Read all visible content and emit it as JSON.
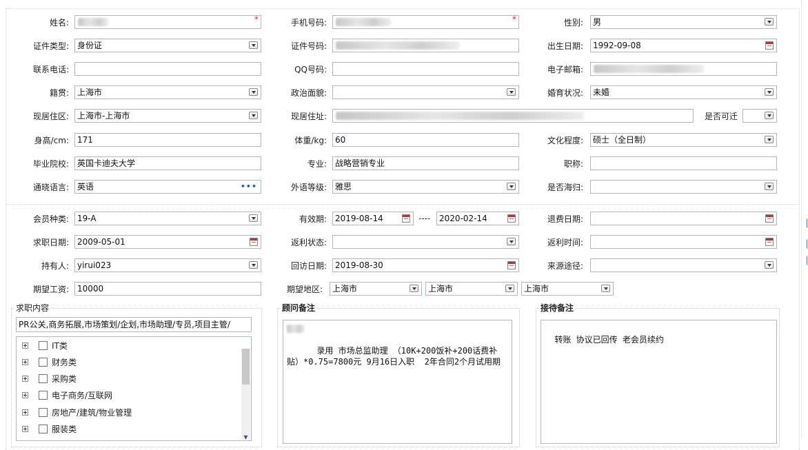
{
  "row1": {
    "name_label": "姓名:",
    "phone_label": "手机号码:",
    "gender_label": "性别:",
    "gender_value": "男"
  },
  "row2": {
    "idtype_label": "证件类型:",
    "idtype_value": "身份证",
    "idnum_label": "证件号码:",
    "birth_label": "出生日期:",
    "birth_value": "1992-09-08"
  },
  "row3": {
    "tel_label": "联系电话:",
    "qq_label": "QQ号码:",
    "email_label": "电子邮箱:"
  },
  "row4": {
    "native_label": "籍贯:",
    "native_value": "上海市",
    "political_label": "政治面貌:",
    "marital_label": "婚育状况:",
    "marital_value": "未婚"
  },
  "row5": {
    "area_label": "现居住区:",
    "area_value": "上海市-上海市",
    "addr_label": "现居住址:",
    "relocate_label": "是否可迁"
  },
  "row6": {
    "height_label": "身高/cm:",
    "height_value": "171",
    "weight_label": "体重/kg:",
    "weight_value": "60",
    "edu_label": "文化程度:",
    "edu_value": "硕士（全日制）"
  },
  "row7": {
    "school_label": "毕业院校:",
    "school_value": "英国卡迪夫大学",
    "major_label": "专业:",
    "major_value": "战略营销专业",
    "title_label": "职称:"
  },
  "row8": {
    "lang_label": "通晓语言:",
    "lang_value": "英语",
    "lang_more": "•••",
    "level_label": "外语等级:",
    "level_value": "雅思",
    "returnee_label": "是否海归:"
  },
  "row9": {
    "member_label": "会员种类:",
    "member_value": "19-A",
    "valid_label": "有效期:",
    "valid_from": "2019-08-14",
    "valid_sep": "----",
    "valid_to": "2020-02-14",
    "refund_label": "退费日期:"
  },
  "row10": {
    "jobdate_label": "求职日期:",
    "jobdate_value": "2009-05-01",
    "rebate_status_label": "返利状态:",
    "rebate_time_label": "返利时间:"
  },
  "row11": {
    "holder_label": "持有人:",
    "holder_value": "yirui023",
    "visit_label": "回访日期:",
    "visit_value": "2019-08-30",
    "source_label": "来源途径:"
  },
  "row12": {
    "salary_label": "期望工资:",
    "salary_value": "10000",
    "region_label": "期望地区:",
    "region1": "上海市",
    "region2": "上海市",
    "region3": "上海市"
  },
  "job": {
    "legend": "求职内容",
    "summary": "PR公关,商务拓展,市场策划/企划,市场助理/专员,项目主管/",
    "tree": [
      "IT类",
      "财务类",
      "采购类",
      "电子商务/互联网",
      "房地产/建筑/物业管理",
      "服装类"
    ]
  },
  "advisor": {
    "legend": "顾问备注",
    "text": "    录用 市场总监助理 （10K+200饭补+200话费补贴）*0.75=7800元 9月16日入职  2年合同2个月试用期"
  },
  "reception": {
    "legend": "接待备注",
    "text": "转账 协议已回传 老会员续约"
  },
  "colors": {
    "border": "#a9b7c6",
    "required": "#e02020",
    "link": "#1a5bb8"
  },
  "icons": [
    "dropdown-arrow-icon",
    "calendar-icon",
    "more-dots-icon",
    "tree-expand-icon",
    "checkbox-icon"
  ]
}
